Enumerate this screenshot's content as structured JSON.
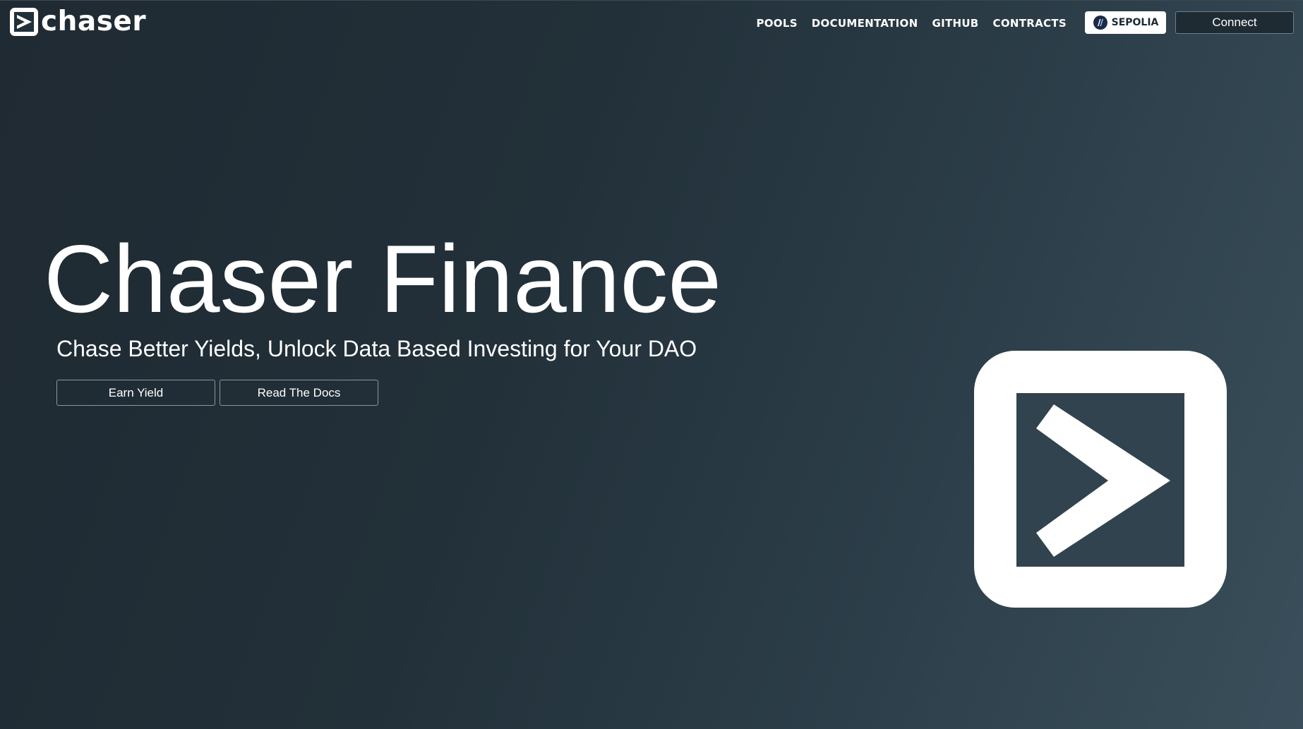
{
  "header": {
    "brand_name": "chaser",
    "nav": [
      {
        "label": "POOLS"
      },
      {
        "label": "DOCUMENTATION"
      },
      {
        "label": "GITHUB"
      },
      {
        "label": "CONTRACTS"
      }
    ],
    "network_label": "SEPOLIA",
    "connect_label": "Connect"
  },
  "hero": {
    "title": "Chaser Finance",
    "subtitle": "Chase Better Yields, Unlock Data Based Investing for Your DAO",
    "primary_button": "Earn Yield",
    "secondary_button": "Read The Docs"
  },
  "colors": {
    "background_start": "#1f2a32",
    "background_end": "#3a4f5b",
    "foreground": "#ffffff"
  },
  "icons": {
    "brand": "chaser-logo-icon",
    "network": "network-icon",
    "hero": "chaser-large-logo-icon"
  }
}
